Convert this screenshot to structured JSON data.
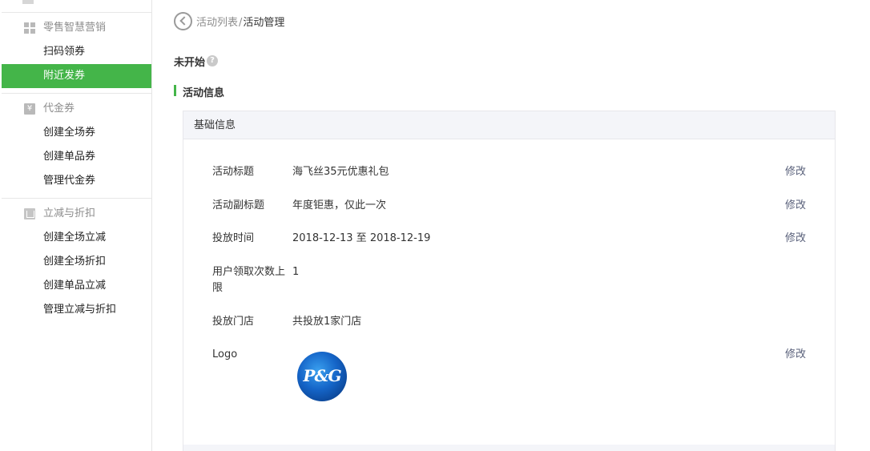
{
  "sidebar": {
    "groups": [
      {
        "title": "零售智慧营销",
        "icon": "grid-icon",
        "items": [
          {
            "label": "扫码领券",
            "active": false
          },
          {
            "label": "附近发券",
            "active": true
          }
        ]
      },
      {
        "title": "代金券",
        "icon": "yen-icon",
        "items": [
          {
            "label": "创建全场券",
            "active": false
          },
          {
            "label": "创建单品券",
            "active": false
          },
          {
            "label": "管理代金券",
            "active": false
          }
        ]
      },
      {
        "title": "立减与折扣",
        "icon": "discount-icon",
        "items": [
          {
            "label": "创建全场立减",
            "active": false
          },
          {
            "label": "创建全场折扣",
            "active": false
          },
          {
            "label": "创建单品立减",
            "active": false
          },
          {
            "label": "管理立减与折扣",
            "active": false
          }
        ]
      }
    ],
    "yen_glyph": "¥",
    "active_color": "#44b549"
  },
  "breadcrumb": {
    "parent": "活动列表",
    "separator": "/",
    "current": "活动管理"
  },
  "status": {
    "text": "未开始",
    "help_glyph": "?"
  },
  "section": {
    "title": "活动信息"
  },
  "panel": {
    "header": "基础信息",
    "rows": [
      {
        "label": "活动标题",
        "value": "海飞丝35元优惠礼包",
        "edit": "修改"
      },
      {
        "label": "活动副标题",
        "value": "年度钜惠，仅此一次",
        "edit": "修改"
      },
      {
        "label": "投放时间",
        "value": "2018-12-13 至 2018-12-19",
        "edit": "修改"
      },
      {
        "label": "用户领取次数上限",
        "value": "1",
        "edit": ""
      },
      {
        "label": "投放门店",
        "value": "共投放1家门店",
        "edit": ""
      },
      {
        "label": "Logo",
        "value": "",
        "edit": "修改"
      }
    ],
    "logo_text": "P&G"
  }
}
